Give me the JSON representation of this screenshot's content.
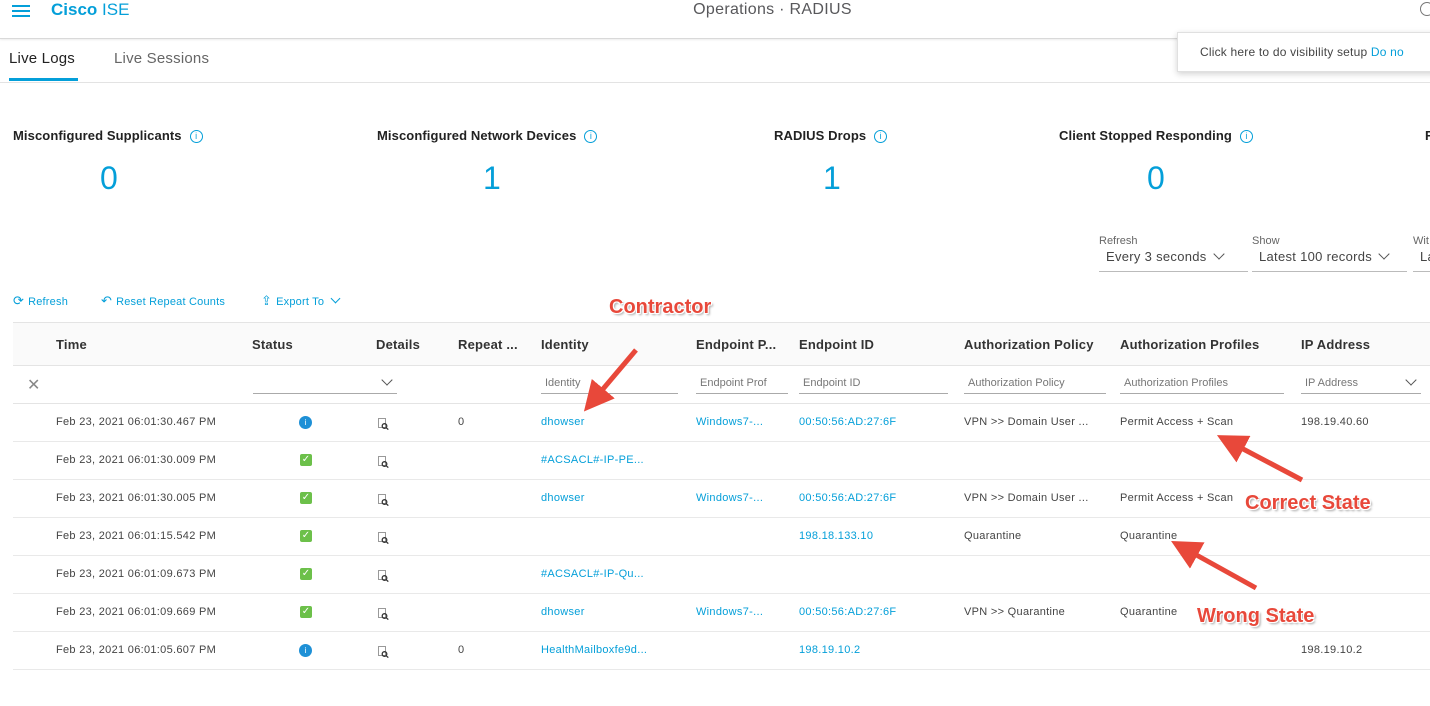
{
  "header": {
    "brand_bold": "Cisco",
    "brand_light": "ISE",
    "title": "Operations · RADIUS"
  },
  "tabs": [
    {
      "label": "Live Logs",
      "active": true
    },
    {
      "label": "Live Sessions",
      "active": false
    }
  ],
  "visibility_popup": {
    "text": "Click here to do visibility setup",
    "link": "Do no"
  },
  "metrics": [
    {
      "label": "Misconfigured Supplicants",
      "value": "0"
    },
    {
      "label": "Misconfigured Network Devices",
      "value": "1"
    },
    {
      "label": "RADIUS Drops",
      "value": "1"
    },
    {
      "label": "Client Stopped Responding",
      "value": "0"
    },
    {
      "label": "R",
      "value": ""
    }
  ],
  "filters": {
    "refresh": {
      "label": "Refresh",
      "value": "Every 3 seconds"
    },
    "show": {
      "label": "Show",
      "value": "Latest 100 records"
    },
    "within": {
      "label": "Wit",
      "value": "La"
    }
  },
  "toolbar": {
    "refresh": "Refresh",
    "reset": "Reset Repeat Counts",
    "export": "Export To"
  },
  "table": {
    "columns": [
      "Time",
      "Status",
      "Details",
      "Repeat ...",
      "Identity",
      "Endpoint P...",
      "Endpoint ID",
      "Authorization Policy",
      "Authorization Profiles",
      "IP Address"
    ],
    "filter_placeholders": {
      "identity": "Identity",
      "endpoint_profile": "Endpoint Prof",
      "endpoint_id": "Endpoint ID",
      "authz_policy": "Authorization Policy",
      "authz_profiles": "Authorization Profiles",
      "ip": "IP Address"
    },
    "rows": [
      {
        "time": "Feb 23, 2021 06:01:30.467 PM",
        "status": "info",
        "repeat": "0",
        "identity": "dhowser",
        "endpoint_profile": "Windows7-...",
        "endpoint_id": "00:50:56:AD:27:6F",
        "authz_policy": "VPN >> Domain User ...",
        "authz_profiles": "Permit Access + Scan",
        "ip": "198.19.40.60"
      },
      {
        "time": "Feb 23, 2021 06:01:30.009 PM",
        "status": "ok",
        "repeat": "",
        "identity": "#ACSACL#-IP-PE...",
        "endpoint_profile": "",
        "endpoint_id": "",
        "authz_policy": "",
        "authz_profiles": "",
        "ip": ""
      },
      {
        "time": "Feb 23, 2021 06:01:30.005 PM",
        "status": "ok",
        "repeat": "",
        "identity": "dhowser",
        "endpoint_profile": "Windows7-...",
        "endpoint_id": "00:50:56:AD:27:6F",
        "authz_policy": "VPN >> Domain User ...",
        "authz_profiles": "Permit Access + Scan",
        "ip": ""
      },
      {
        "time": "Feb 23, 2021 06:01:15.542 PM",
        "status": "ok",
        "repeat": "",
        "identity": "",
        "endpoint_profile": "",
        "endpoint_id": "198.18.133.10",
        "authz_policy": "Quarantine",
        "authz_profiles": "Quarantine",
        "ip": ""
      },
      {
        "time": "Feb 23, 2021 06:01:09.673 PM",
        "status": "ok",
        "repeat": "",
        "identity": "#ACSACL#-IP-Qu...",
        "endpoint_profile": "",
        "endpoint_id": "",
        "authz_policy": "",
        "authz_profiles": "",
        "ip": ""
      },
      {
        "time": "Feb 23, 2021 06:01:09.669 PM",
        "status": "ok",
        "repeat": "",
        "identity": "dhowser",
        "endpoint_profile": "Windows7-...",
        "endpoint_id": "00:50:56:AD:27:6F",
        "authz_policy": "VPN >> Quarantine",
        "authz_profiles": "Quarantine",
        "ip": ""
      },
      {
        "time": "Feb 23, 2021 06:01:05.607 PM",
        "status": "info",
        "repeat": "0",
        "identity": "HealthMailboxfe9d...",
        "endpoint_profile": "",
        "endpoint_id": "198.19.10.2",
        "authz_policy": "",
        "authz_profiles": "",
        "ip": "198.19.10.2"
      }
    ]
  },
  "annotations": {
    "contractor": "Contractor",
    "correct": "Correct State",
    "wrong": "Wrong State"
  },
  "colors": {
    "accent": "#049fd9",
    "annotation": "#e8483a",
    "status_ok": "#6cc04a",
    "status_info": "#1e90d6"
  }
}
